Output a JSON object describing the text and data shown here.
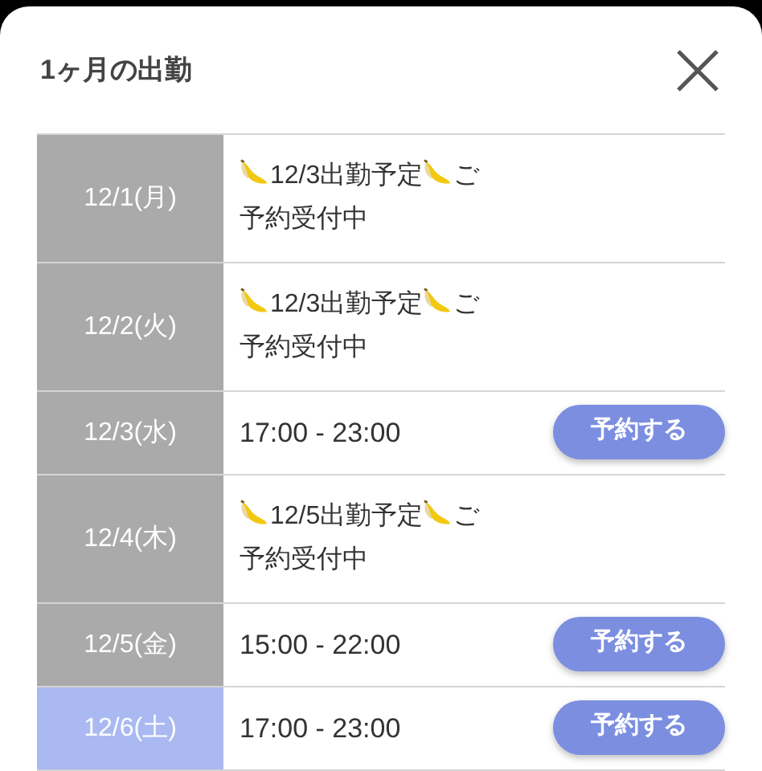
{
  "dialog": {
    "title": "1ヶ月の出勤"
  },
  "rows": [
    {
      "date": "12/1(月)",
      "color": "#aaaaaa",
      "kind": "note",
      "note": [
        {
          "kind": "banana"
        },
        {
          "kind": "text",
          "text": "12/3出勤予定"
        },
        {
          "kind": "banana"
        },
        {
          "kind": "text",
          "text": "ご"
        },
        {
          "kind": "break"
        },
        {
          "kind": "text",
          "text": "予約受付中"
        }
      ]
    },
    {
      "date": "12/2(火)",
      "color": "#aaaaaa",
      "kind": "note",
      "note": [
        {
          "kind": "banana"
        },
        {
          "kind": "text",
          "text": "12/3出勤予定"
        },
        {
          "kind": "banana"
        },
        {
          "kind": "text",
          "text": "ご"
        },
        {
          "kind": "break"
        },
        {
          "kind": "text",
          "text": "予約受付中"
        }
      ]
    },
    {
      "date": "12/3(水)",
      "color": "#aaaaaa",
      "kind": "shift",
      "time": "17:00 - 23:00",
      "button": "予約する"
    },
    {
      "date": "12/4(木)",
      "color": "#aaaaaa",
      "kind": "note",
      "note": [
        {
          "kind": "banana"
        },
        {
          "kind": "text",
          "text": "12/5出勤予定"
        },
        {
          "kind": "banana"
        },
        {
          "kind": "text",
          "text": "ご"
        },
        {
          "kind": "break"
        },
        {
          "kind": "text",
          "text": "予約受付中"
        }
      ]
    },
    {
      "date": "12/5(金)",
      "color": "#aaaaaa",
      "kind": "shift",
      "time": "15:00 - 22:00",
      "button": "予約する"
    },
    {
      "date": "12/6(土)",
      "color": "#aab9f1",
      "kind": "shift",
      "time": "17:00 - 23:00",
      "button": "予約する"
    }
  ]
}
